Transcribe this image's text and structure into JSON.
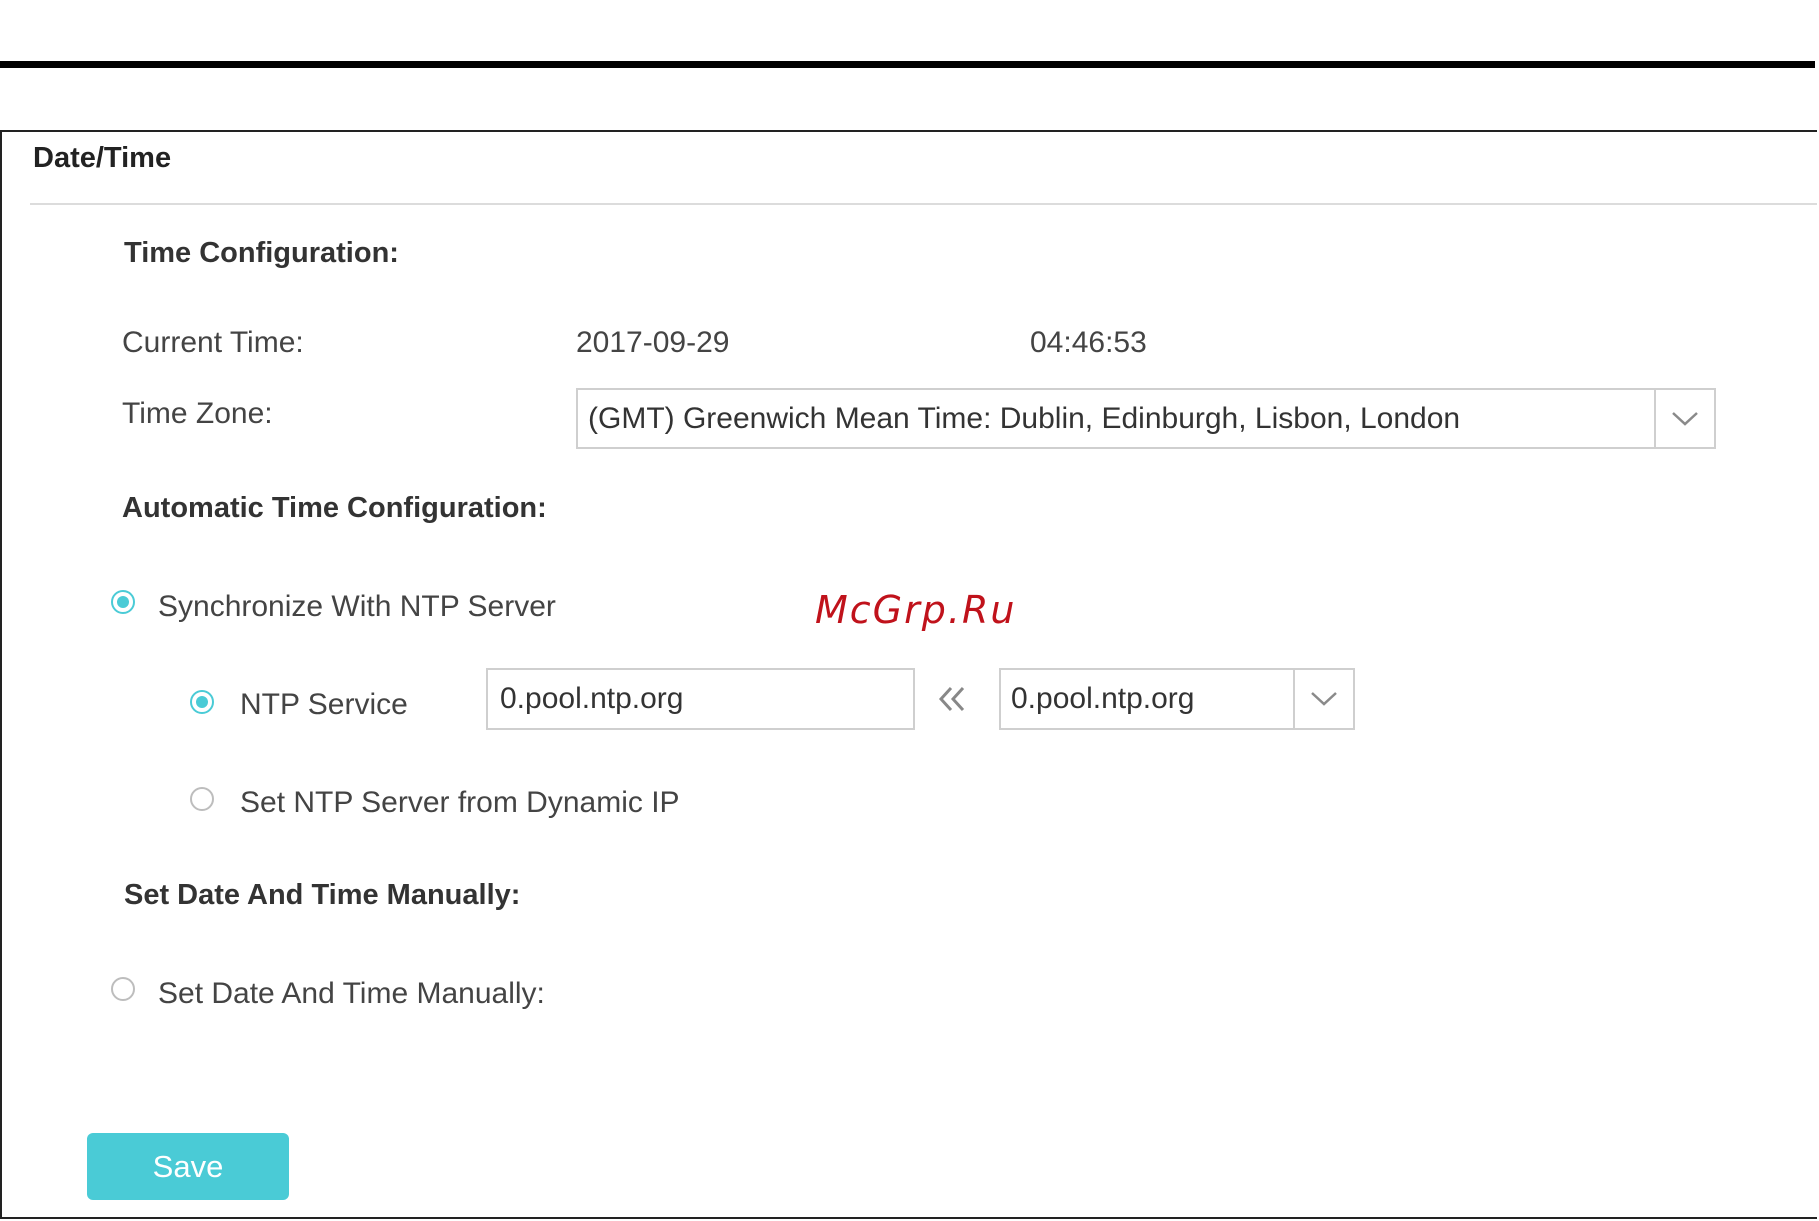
{
  "panel": {
    "title": "Date/Time"
  },
  "time_config": {
    "heading": "Time Configuration:",
    "current_time_label": "Current Time:",
    "current_date": "2017-09-29",
    "current_time": "04:46:53",
    "time_zone_label": "Time Zone:",
    "time_zone_value": "(GMT) Greenwich Mean Time: Dublin, Edinburgh, Lisbon, London"
  },
  "auto_config": {
    "heading": "Automatic Time Configuration:",
    "sync_ntp_label": "Synchronize With NTP Server",
    "sync_ntp_checked": true,
    "ntp_service_label": "NTP Service",
    "ntp_service_checked": true,
    "ntp_input_value": "0.pool.ntp.org",
    "ntp_select_value": "0.pool.ntp.org",
    "dynamic_ip_label": "Set NTP Server from Dynamic IP",
    "dynamic_ip_checked": false
  },
  "manual_config": {
    "heading": "Set Date And Time Manually:",
    "manual_label": "Set Date And Time Manually:",
    "manual_checked": false
  },
  "watermark": "McGrp.Ru",
  "save_label": "Save",
  "colors": {
    "accent": "#4acbd6",
    "border": "#cfcfcf",
    "watermark": "#c0121b"
  },
  "icons": {
    "dropdown": "chevron-down-icon",
    "copy_arrow": "double-chevron-left-icon"
  }
}
